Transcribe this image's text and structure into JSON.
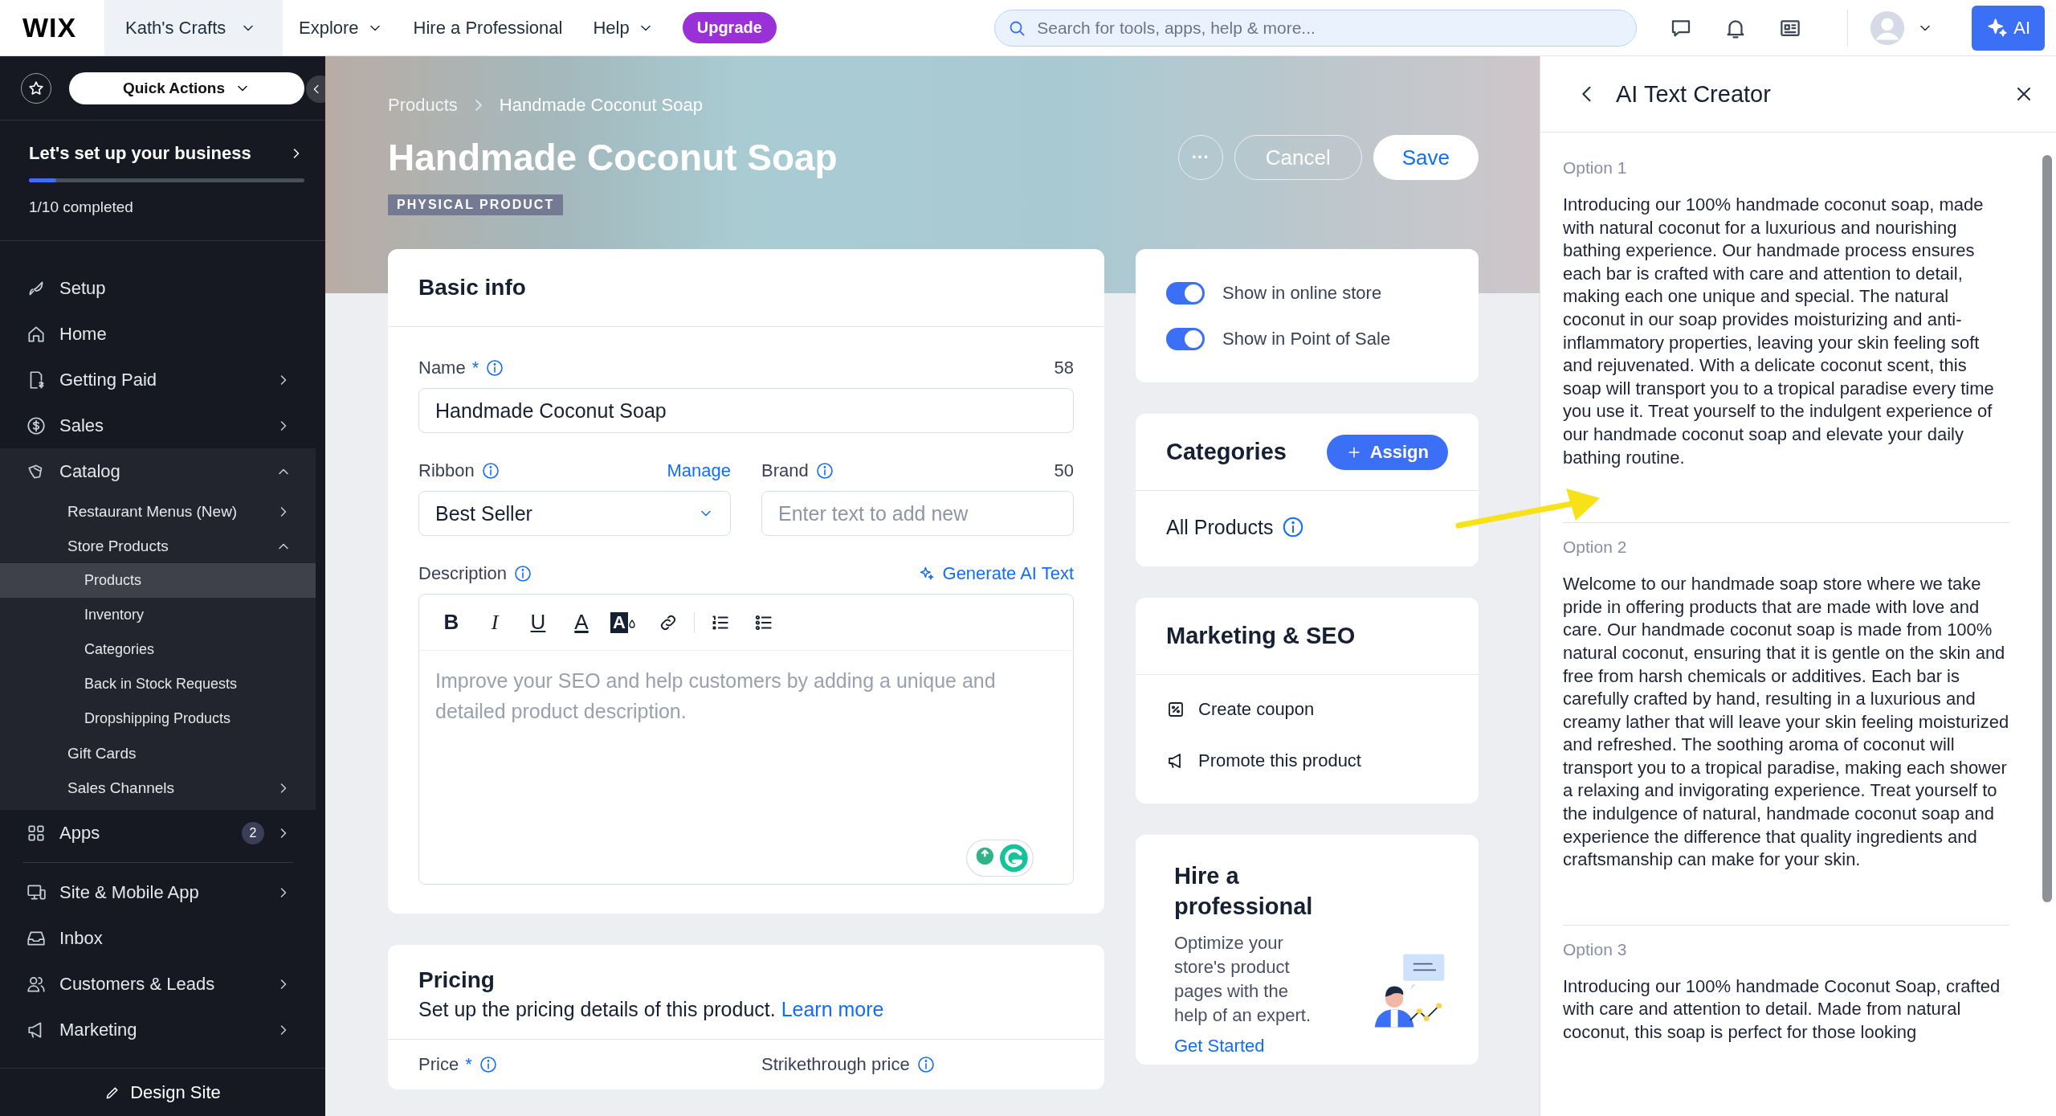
{
  "top_bar": {
    "logo": "WIX",
    "site_name": "Kath's Crafts",
    "nav": [
      {
        "label": "Explore",
        "has_menu": true
      },
      {
        "label": "Hire a Professional",
        "has_menu": false
      },
      {
        "label": "Help",
        "has_menu": true
      }
    ],
    "upgrade": "Upgrade",
    "search": {
      "placeholder": "Search for tools, apps, help & more..."
    },
    "ai_button": "AI"
  },
  "sidebar": {
    "quick_actions": "Quick Actions",
    "setup": {
      "title": "Let's set up your business",
      "progress_text": "1/10 completed",
      "level": 0.1
    },
    "groups": [
      [
        {
          "label": "Setup",
          "selected": false
        },
        {
          "label": "Home",
          "selected": false
        },
        {
          "label": "Getting Paid",
          "expanded": false,
          "selected": false
        },
        {
          "label": "Sales",
          "expanded": false,
          "selected": false
        },
        {
          "label": "Catalog",
          "expanded": true,
          "selected": false,
          "children": [
            {
              "label": "Restaurant Menus (New)",
              "expanded": false,
              "selected": false
            },
            {
              "label": "Store Products",
              "expanded": true,
              "selected": false,
              "children": [
                {
                  "label": "Products",
                  "selected": true
                },
                {
                  "label": "Inventory",
                  "selected": false
                },
                {
                  "label": "Categories",
                  "selected": false
                },
                {
                  "label": "Back in Stock Requests",
                  "selected": false
                },
                {
                  "label": "Dropshipping Products",
                  "selected": false
                }
              ]
            },
            {
              "label": "Gift Cards",
              "selected": false
            },
            {
              "label": "Sales Channels",
              "expanded": false,
              "selected": false
            }
          ]
        },
        {
          "label": "Apps",
          "badge": "2",
          "expanded": false,
          "selected": false
        }
      ],
      [
        {
          "label": "Site & Mobile App",
          "expanded": false,
          "selected": false
        },
        {
          "label": "Inbox",
          "selected": false
        },
        {
          "label": "Customers & Leads",
          "expanded": false,
          "selected": false
        },
        {
          "label": "Marketing",
          "expanded": false,
          "selected": false
        }
      ]
    ],
    "footer": "Design Site"
  },
  "header": {
    "breadcrumb": [
      "Products",
      "Handmade Coconut Soap"
    ],
    "title": "Handmade Coconut Soap",
    "badge": "PHYSICAL PRODUCT",
    "more": "···",
    "cancel": "Cancel",
    "save": "Save"
  },
  "basic_info": {
    "title": "Basic info",
    "name": {
      "label": "Name",
      "required_mark": "*",
      "count": "58",
      "value": "Handmade Coconut Soap"
    },
    "ribbon": {
      "label": "Ribbon",
      "link": "Manage",
      "value": "Best Seller"
    },
    "brand": {
      "label": "Brand",
      "count": "50",
      "placeholder": "Enter text to add new"
    },
    "description": {
      "label": "Description",
      "generate": "Generate AI Text",
      "placeholder": "Improve your SEO and help customers by adding a unique and detailed product description.",
      "toolbar": [
        {
          "kind": "bold",
          "glyph": "B"
        },
        {
          "kind": "italic",
          "glyph": "I"
        },
        {
          "kind": "underline",
          "glyph": "U"
        },
        {
          "kind": "text-color",
          "glyph": "A"
        },
        {
          "kind": "highlight",
          "glyph": "A"
        },
        {
          "kind": "link"
        },
        {
          "kind": "numbered-list"
        },
        {
          "kind": "bullet-list"
        }
      ]
    }
  },
  "pricing": {
    "title": "Pricing",
    "subtitle": "Set up the pricing details of this product.",
    "link": "Learn more",
    "fields": [
      {
        "label": "Price",
        "required_mark": "*"
      },
      {
        "label": "Strikethrough price"
      }
    ]
  },
  "visibility": [
    {
      "label": "Show in online store",
      "on": true
    },
    {
      "label": "Show in Point of Sale",
      "on": true
    }
  ],
  "categories": {
    "title": "Categories",
    "assign": "Assign",
    "items": [
      "All Products"
    ]
  },
  "marketing": {
    "title": "Marketing & SEO",
    "actions": [
      "Create coupon",
      "Promote this product"
    ]
  },
  "hire": {
    "title": "Hire a professional",
    "text": "Optimize your store's product pages with the help of an expert.",
    "link": "Get Started"
  },
  "ai_panel": {
    "title": "AI Text Creator",
    "options": [
      {
        "label": "Option 1",
        "text": "Introducing our 100% handmade coconut soap, made with natural coconut for a luxurious and nourishing bathing experience. Our handmade process ensures each bar is crafted with care and attention to detail, making each one unique and special. The natural coconut in our soap provides moisturizing and anti-inflammatory properties, leaving your skin feeling soft and rejuvenated. With a delicate coconut scent, this soap will transport you to a tropical paradise every time you use it. Treat yourself to the indulgent experience of our handmade coconut soap and elevate your daily bathing routine."
      },
      {
        "label": "Option 2",
        "text": "Welcome to our handmade soap store where we take pride in offering products that are made with love and care. Our handmade coconut soap is made from 100% natural coconut, ensuring that it is gentle on the skin and free from harsh chemicals or additives. Each bar is carefully crafted by hand, resulting in a luxurious and creamy lather that will leave your skin feeling moisturized and refreshed. The soothing aroma of coconut will transport you to a tropical paradise, making each shower a relaxing and invigorating experience. Treat yourself to the indulgence of natural, handmade coconut soap and experience the difference that quality ingredients and craftsmanship can make for your skin."
      },
      {
        "label": "Option 3",
        "text": "Introducing our 100% handmade Coconut Soap, crafted with care and attention to detail. Made from natural coconut, this soap is perfect for those looking"
      }
    ]
  }
}
